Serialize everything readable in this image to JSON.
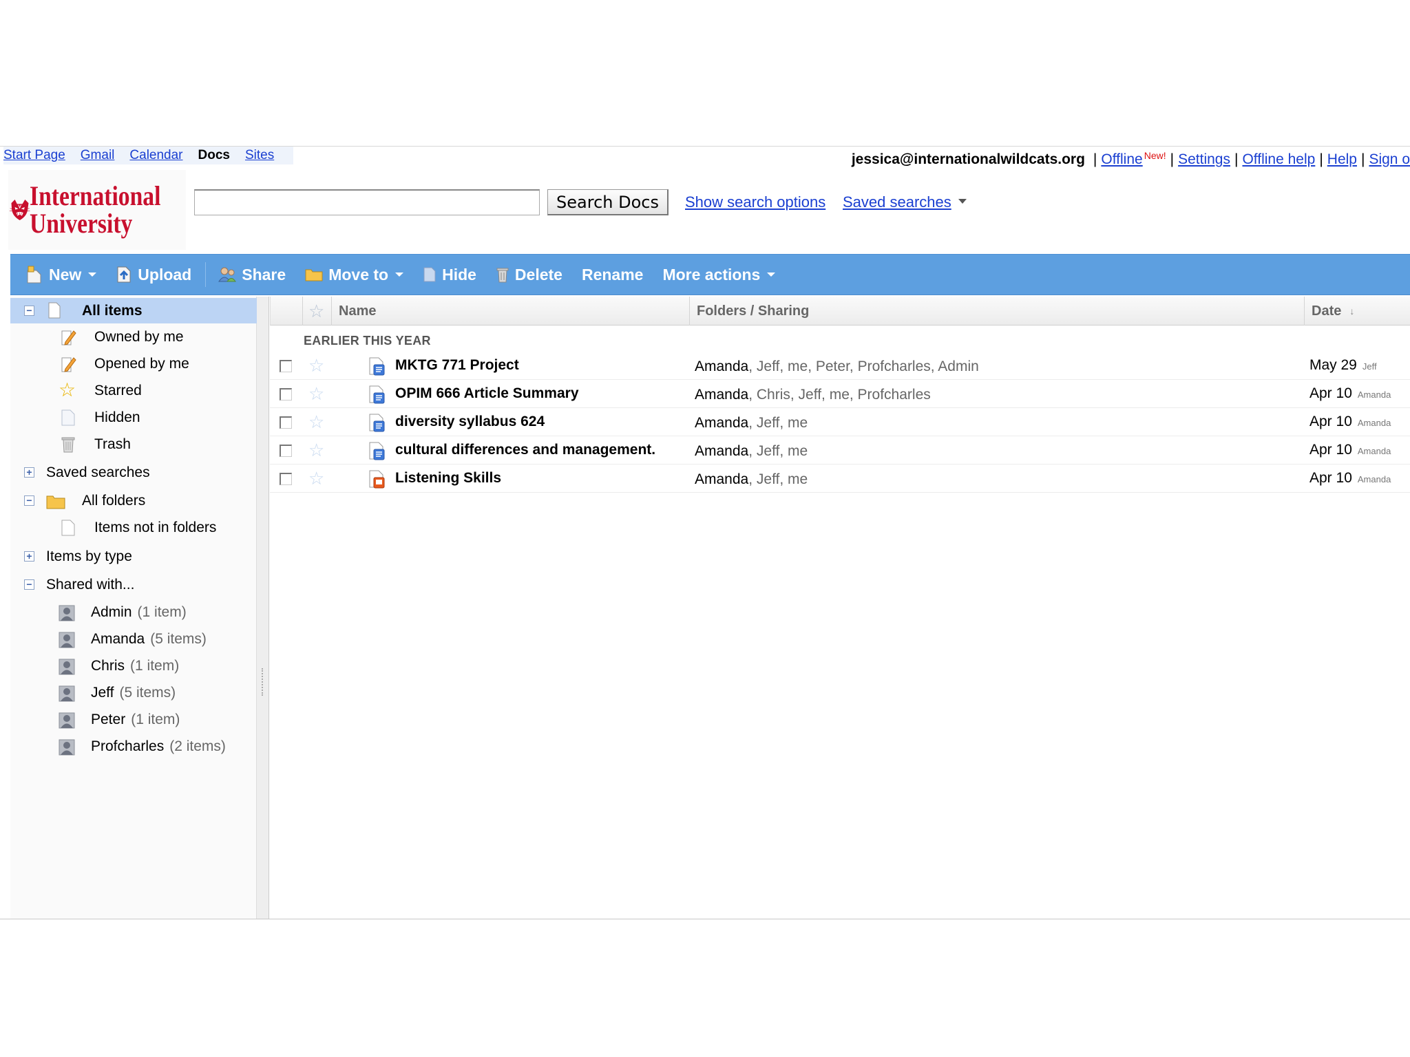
{
  "topnav": {
    "links": [
      "Start Page",
      "Gmail",
      "Calendar",
      "Docs",
      "Sites"
    ]
  },
  "account": {
    "email": "jessica@internationalwildcats.org",
    "offline": "Offline",
    "new_badge": "New!",
    "settings": "Settings",
    "offline_help": "Offline help",
    "help": "Help",
    "sign_out": "Sign o"
  },
  "logo": {
    "line1": "International",
    "line2": "University",
    "brand_color": "#c8102e"
  },
  "search": {
    "value": "",
    "button": "Search Docs",
    "show_options": "Show search options",
    "saved_searches": "Saved searches"
  },
  "toolbar": {
    "new": "New",
    "upload": "Upload",
    "share": "Share",
    "move_to": "Move to",
    "hide": "Hide",
    "delete": "Delete",
    "rename": "Rename",
    "more_actions": "More actions"
  },
  "sidebar": {
    "all_items": "All items",
    "owned_by_me": "Owned by me",
    "opened_by_me": "Opened by me",
    "starred": "Starred",
    "hidden": "Hidden",
    "trash": "Trash",
    "saved_searches": "Saved searches",
    "all_folders": "All folders",
    "items_not_in_folders": "Items not in folders",
    "items_by_type": "Items by type",
    "shared_with": "Shared with...",
    "people": [
      {
        "name": "Admin",
        "count": "(1 item)"
      },
      {
        "name": "Amanda",
        "count": "(5 items)"
      },
      {
        "name": "Chris",
        "count": "(1 item)"
      },
      {
        "name": "Jeff",
        "count": "(5 items)"
      },
      {
        "name": "Peter",
        "count": "(1 item)"
      },
      {
        "name": "Profcharles",
        "count": "(2 items)"
      }
    ]
  },
  "list": {
    "columns": {
      "name": "Name",
      "sharing": "Folders / Sharing",
      "date": "Date"
    },
    "group": "EARLIER THIS YEAR",
    "rows": [
      {
        "name": "MKTG 771 Project",
        "owner": "Amanda",
        "others": ", Jeff, me, Peter, Profcharles, Admin",
        "date": "May 29",
        "by": "Jeff",
        "type": "document"
      },
      {
        "name": "OPIM 666 Article Summary",
        "owner": "Amanda",
        "others": ", Chris, Jeff, me, Profcharles",
        "date": "Apr 10",
        "by": "Amanda",
        "type": "document"
      },
      {
        "name": "diversity syllabus 624",
        "owner": "Amanda",
        "others": ", Jeff, me",
        "date": "Apr 10",
        "by": "Amanda",
        "type": "document"
      },
      {
        "name": "cultural differences and management.",
        "owner": "Amanda",
        "others": ", Jeff, me",
        "date": "Apr 10",
        "by": "Amanda",
        "type": "document"
      },
      {
        "name": "Listening Skills",
        "owner": "Amanda",
        "others": ", Jeff, me",
        "date": "Apr 10",
        "by": "Amanda",
        "type": "presentation"
      }
    ]
  },
  "colors": {
    "toolbar": "#5d9fe0",
    "selected": "#bcd4f4",
    "link": "#1a3fd1"
  }
}
